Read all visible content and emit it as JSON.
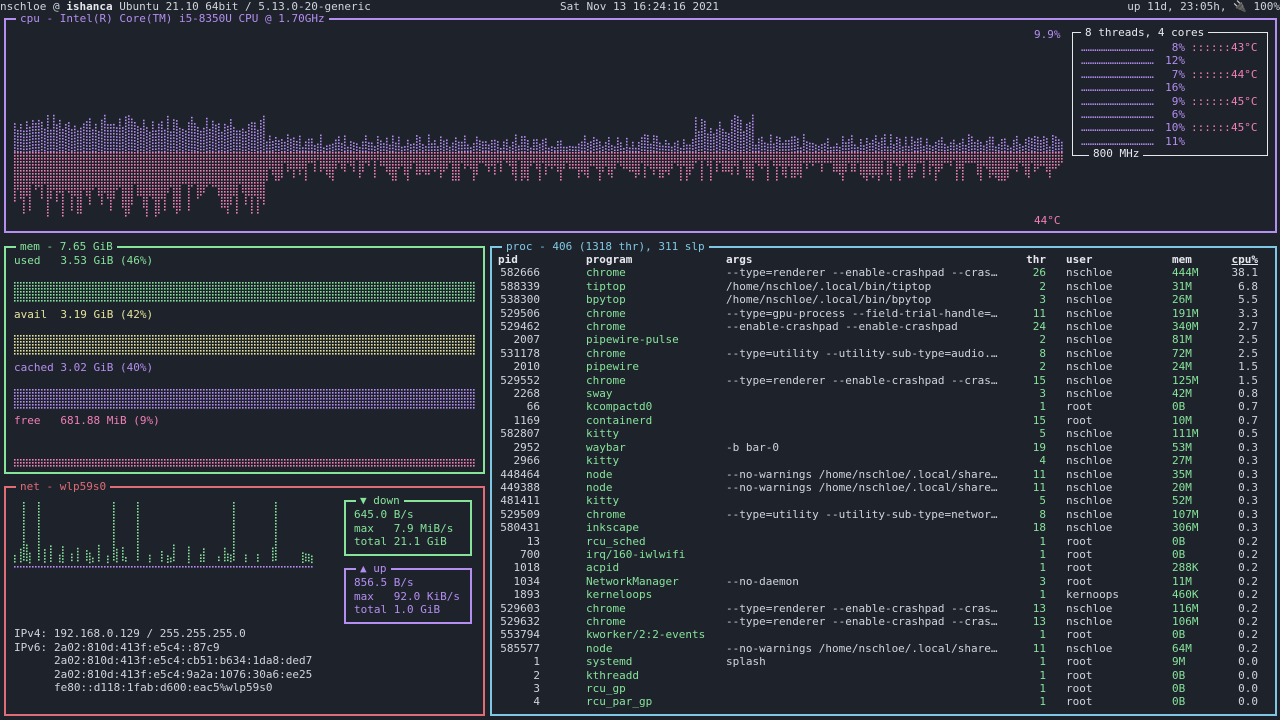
{
  "topbar": {
    "user": "nschloe",
    "at": " @ ",
    "host": "ishanca",
    "os": " Ubuntu 21.10 64bit / 5.13.0-20-generic",
    "datetime": "Sat Nov 13 16:24:16 2021",
    "uptime": "up 11d, 23:05h, ",
    "battery_icon": "plug-icon",
    "battery": "100%"
  },
  "cpu": {
    "title": "cpu - Intel(R) Core(TM) i5-8350U CPU @ 1.70GHz",
    "usage": "9.9%",
    "temp": "44°C",
    "threads_title": "8 threads, 4 cores",
    "freq": "800 MHz",
    "threads": [
      {
        "pct": "8%",
        "temp": "43°C"
      },
      {
        "pct": "12%",
        "temp": ""
      },
      {
        "pct": "7%",
        "temp": "44°C"
      },
      {
        "pct": "16%",
        "temp": ""
      },
      {
        "pct": "9%",
        "temp": "45°C"
      },
      {
        "pct": "6%",
        "temp": ""
      },
      {
        "pct": "10%",
        "temp": "45°C"
      },
      {
        "pct": "11%",
        "temp": ""
      }
    ]
  },
  "mem": {
    "title": "mem - 7.65 GiB",
    "used_label": "used",
    "used_value": "3.53 GiB (46%)",
    "used_fraction": 0.46,
    "avail_label": "avail",
    "avail_value": "3.19 GiB (42%)",
    "avail_fraction": 0.42,
    "cached_label": "cached",
    "cached_value": "3.02 GiB (40%)",
    "cached_fraction": 0.4,
    "free_label": "free",
    "free_value": "681.88 MiB (9%)",
    "free_fraction": 0.09
  },
  "net": {
    "title": "net - wlp59s0",
    "down_title": "▼ down",
    "down_rate": "645.0 B/s",
    "down_max_label": "max",
    "down_max": "7.9 MiB/s",
    "down_total_label": "total",
    "down_total": "21.1 GiB",
    "up_title": "▲ up",
    "up_rate": "856.5 B/s",
    "up_max_label": "max",
    "up_max": "92.0 KiB/s",
    "up_total_label": "total",
    "up_total": "1.0 GiB",
    "ipv4_label": "IPv4:",
    "ipv4": "192.168.0.129 / 255.255.255.0",
    "ipv6_label": "IPv6:",
    "ipv6": [
      "2a02:810d:413f:e5c4::87c9",
      "2a02:810d:413f:e5c4:cb51:b634:1da8:ded7",
      "2a02:810d:413f:e5c4:9a2a:1076:30a6:ee25",
      "fe80::d118:1fab:d600:eac5%wlp59s0"
    ]
  },
  "proc": {
    "title": "proc - 406 (1318 thr), 311 slp",
    "headers": {
      "pid": "pid",
      "program": "program",
      "args": "args",
      "thr": "thr",
      "user": "user",
      "mem": "mem",
      "cpu": "cpu%"
    },
    "rows": [
      [
        "582666",
        "chrome",
        "--type=renderer --enable-crashpad --cras…",
        "26",
        "nschloe",
        "444M",
        "38.1"
      ],
      [
        "588339",
        "tiptop",
        "/home/nschloe/.local/bin/tiptop",
        "2",
        "nschloe",
        "31M",
        "6.8"
      ],
      [
        "538300",
        "bpytop",
        "/home/nschloe/.local/bin/bpytop",
        "3",
        "nschloe",
        "26M",
        "5.5"
      ],
      [
        "529506",
        "chrome",
        "--type=gpu-process --field-trial-handle=…",
        "11",
        "nschloe",
        "191M",
        "3.3"
      ],
      [
        "529462",
        "chrome",
        "--enable-crashpad --enable-crashpad",
        "24",
        "nschloe",
        "340M",
        "2.7"
      ],
      [
        "2007",
        "pipewire-pulse",
        "",
        "2",
        "nschloe",
        "81M",
        "2.5"
      ],
      [
        "531178",
        "chrome",
        "--type=utility --utility-sub-type=audio.…",
        "8",
        "nschloe",
        "72M",
        "2.5"
      ],
      [
        "2010",
        "pipewire",
        "",
        "2",
        "nschloe",
        "24M",
        "1.5"
      ],
      [
        "529552",
        "chrome",
        "--type=renderer --enable-crashpad --cras…",
        "15",
        "nschloe",
        "125M",
        "1.5"
      ],
      [
        "2268",
        "sway",
        "",
        "3",
        "nschloe",
        "42M",
        "0.8"
      ],
      [
        "66",
        "kcompactd0",
        "",
        "1",
        "root",
        "0B",
        "0.7"
      ],
      [
        "1169",
        "containerd",
        "",
        "15",
        "root",
        "10M",
        "0.7"
      ],
      [
        "582807",
        "kitty",
        "",
        "5",
        "nschloe",
        "111M",
        "0.5"
      ],
      [
        "2952",
        "waybar",
        "-b bar-0",
        "19",
        "nschloe",
        "53M",
        "0.3"
      ],
      [
        "2966",
        "kitty",
        "",
        "4",
        "nschloe",
        "27M",
        "0.3"
      ],
      [
        "448464",
        "node",
        "--no-warnings /home/nschloe/.local/share…",
        "11",
        "nschloe",
        "35M",
        "0.3"
      ],
      [
        "449388",
        "node",
        "--no-warnings /home/nschloe/.local/share…",
        "11",
        "nschloe",
        "20M",
        "0.3"
      ],
      [
        "481411",
        "kitty",
        "",
        "5",
        "nschloe",
        "52M",
        "0.3"
      ],
      [
        "529509",
        "chrome",
        "--type=utility --utility-sub-type=networ…",
        "8",
        "nschloe",
        "107M",
        "0.3"
      ],
      [
        "580431",
        "inkscape",
        "",
        "18",
        "nschloe",
        "306M",
        "0.3"
      ],
      [
        "13",
        "rcu_sched",
        "",
        "1",
        "root",
        "0B",
        "0.2"
      ],
      [
        "700",
        "irq/160-iwlwifi",
        "",
        "1",
        "root",
        "0B",
        "0.2"
      ],
      [
        "1018",
        "acpid",
        "",
        "1",
        "root",
        "288K",
        "0.2"
      ],
      [
        "1034",
        "NetworkManager",
        "--no-daemon",
        "3",
        "root",
        "11M",
        "0.2"
      ],
      [
        "1893",
        "kerneloops",
        "",
        "1",
        "kernoops",
        "460K",
        "0.2"
      ],
      [
        "529603",
        "chrome",
        "--type=renderer --enable-crashpad --cras…",
        "13",
        "nschloe",
        "116M",
        "0.2"
      ],
      [
        "529632",
        "chrome",
        "--type=renderer --enable-crashpad --cras…",
        "13",
        "nschloe",
        "106M",
        "0.2"
      ],
      [
        "553794",
        "kworker/2:2-events",
        "",
        "1",
        "root",
        "0B",
        "0.2"
      ],
      [
        "585577",
        "node",
        "--no-warnings /home/nschloe/.local/share…",
        "11",
        "nschloe",
        "64M",
        "0.2"
      ],
      [
        "1",
        "systemd",
        "splash",
        "1",
        "root",
        "9M",
        "0.0"
      ],
      [
        "2",
        "kthreadd",
        "",
        "1",
        "root",
        "0B",
        "0.0"
      ],
      [
        "3",
        "rcu_gp",
        "",
        "1",
        "root",
        "0B",
        "0.0"
      ],
      [
        "4",
        "rcu_par_gp",
        "",
        "1",
        "root",
        "0B",
        "0.0"
      ]
    ]
  },
  "colors": {
    "cpu_border": "#b48ef0",
    "mem_border": "#86e39a",
    "net_border": "#e06c75",
    "proc_border": "#7ec8e3",
    "graph_top": "#b48ef0",
    "graph_bottom": "#f07fb7"
  }
}
